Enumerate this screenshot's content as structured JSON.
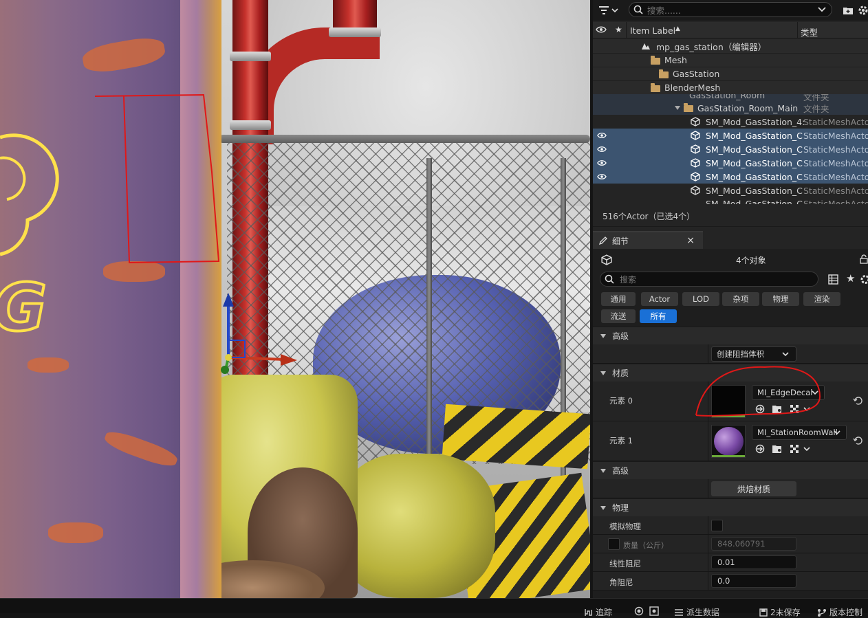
{
  "outliner": {
    "search_placeholder": "搜索......",
    "col_label": "Item Label",
    "col_sort_arrow": "▲",
    "col_type": "类型",
    "rows": [
      {
        "label": "mp_gas_station（编辑器）",
        "type": "",
        "icon": "level-icon"
      },
      {
        "label": "Mesh",
        "type": "",
        "icon": "folder-icon"
      },
      {
        "label": "GasStation",
        "type": "",
        "icon": "folder-icon"
      },
      {
        "label": "BlenderMesh",
        "type": "",
        "icon": "folder-icon"
      },
      {
        "label": "GasStation_Room",
        "type": "文件夹",
        "icon": "folder-icon"
      },
      {
        "label": "GasStation_Room_Main",
        "type": "文件夹",
        "icon": "folder-icon"
      },
      {
        "label": "SM_Mod_GasStation_4:",
        "type": "StaticMeshActo",
        "icon": "static-mesh-icon"
      },
      {
        "label": "SM_Mod_GasStation_C",
        "type": "StaticMeshActo",
        "icon": "static-mesh-icon"
      },
      {
        "label": "SM_Mod_GasStation_C",
        "type": "StaticMeshActo",
        "icon": "static-mesh-icon"
      },
      {
        "label": "SM_Mod_GasStation_C",
        "type": "StaticMeshActo",
        "icon": "static-mesh-icon"
      },
      {
        "label": "SM_Mod_GasStation_C",
        "type": "StaticMeshActo",
        "icon": "static-mesh-icon"
      },
      {
        "label": "SM_Mod_GasStation_C",
        "type": "StaticMeshActo",
        "icon": "static-mesh-icon"
      },
      {
        "label": "SM_Mod_GasStation_C",
        "type": "StaticMeshActo",
        "icon": "static-mesh-icon"
      }
    ],
    "footer": "516个Actor（已选4个）"
  },
  "details": {
    "tab_label": "细节",
    "object_count": "4个对象",
    "search_placeholder": "搜索",
    "filters": [
      "通用",
      "Actor",
      "LOD",
      "杂项",
      "物理",
      "渲染",
      "流送",
      "所有"
    ],
    "active_filter": "所有",
    "sections": {
      "advanced1": "高级",
      "materials": "材质",
      "advanced2": "高级",
      "physics": "物理"
    },
    "create_blocking_volume": "创建阻挡体积",
    "element0_label": "元素 0",
    "element0_material": "MI_EdgeDecal",
    "element1_label": "元素 1",
    "element1_material": "MI_StationRoomWall",
    "bake_material": "烘焙材质",
    "simulate_physics": "模拟物理",
    "mass_label": "质量（公斤）",
    "mass_value": "848.060791",
    "linear_damping_label": "线性阻尼",
    "linear_damping_value": "0.01",
    "angular_damping_label": "角阻尼",
    "angular_damping_value": "0.0"
  },
  "statusbar": {
    "trace": "追踪",
    "derived_data": "派生数据",
    "unsaved": "2未保存",
    "source_control": "版本控制"
  },
  "viewport": {
    "neon_text": "G"
  }
}
